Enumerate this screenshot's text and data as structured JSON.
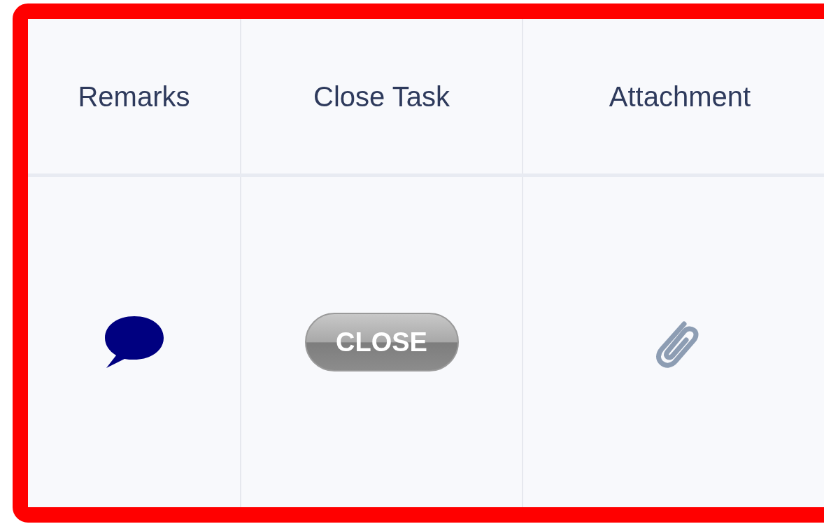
{
  "table": {
    "columns": [
      "Remarks",
      "Close Task",
      "Attachment"
    ],
    "rows": [
      {
        "close_button": "CLOSE"
      }
    ]
  }
}
